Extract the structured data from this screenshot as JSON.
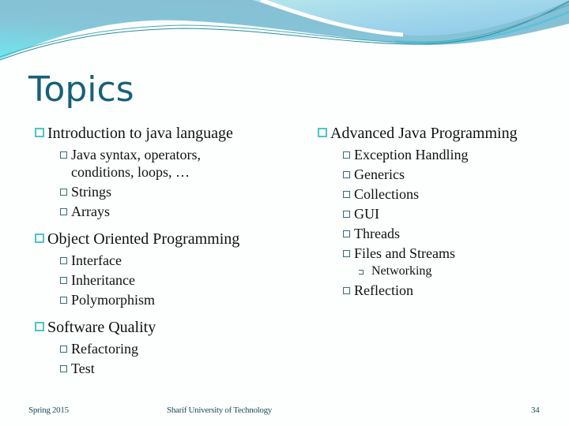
{
  "slide": {
    "title": "Topics",
    "left_column": [
      {
        "label": "Introduction to java language",
        "children": [
          {
            "label": "Java syntax, operators, conditions, loops, …"
          },
          {
            "label": "Strings"
          },
          {
            "label": "Arrays"
          }
        ]
      },
      {
        "label": "Object Oriented Programming",
        "children": [
          {
            "label": "Interface"
          },
          {
            "label": "Inheritance"
          },
          {
            "label": "Polymorphism"
          }
        ]
      },
      {
        "label": "Software Quality",
        "children": [
          {
            "label": "Refactoring"
          },
          {
            "label": "Test"
          }
        ]
      }
    ],
    "right_column": [
      {
        "label": "Advanced Java Programming",
        "children": [
          {
            "label": "Exception Handling"
          },
          {
            "label": "Generics"
          },
          {
            "label": "Collections"
          },
          {
            "label": "GUI"
          },
          {
            "label": "Threads"
          },
          {
            "label": "Files and Streams",
            "children": [
              {
                "label": "Networking"
              }
            ]
          },
          {
            "label": "Reflection"
          }
        ]
      }
    ],
    "footer": {
      "date": "Spring 2015",
      "organization": "Sharif University of Technology",
      "page_number": "34"
    },
    "colors": {
      "title": "#17607a",
      "bullet_l1": "#4cc3cc",
      "bullet_l2": "#3b6a78",
      "header_wave": "#84c3d6"
    }
  }
}
